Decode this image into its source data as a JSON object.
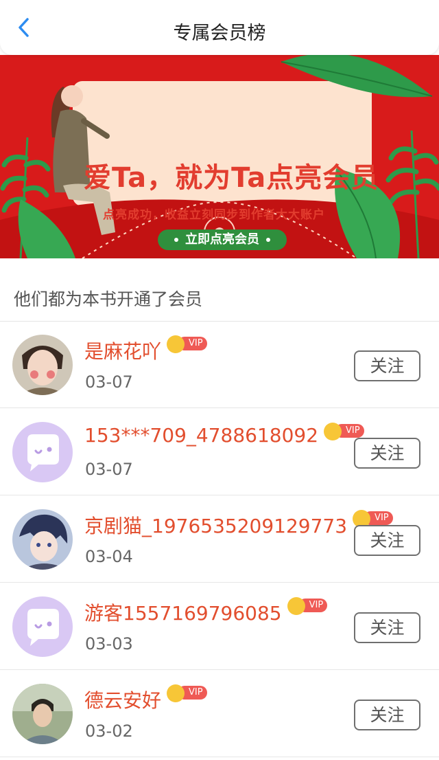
{
  "header": {
    "title": "专属会员榜",
    "back_icon": "chevron-left-icon",
    "back_color": "#2d8cf0"
  },
  "banner": {
    "headline": "爱Ta，就为Ta点亮会员",
    "subtitle": "点亮成功，收益立刻同步到作者大大账户",
    "cta_label": "立即点亮会员",
    "colors": {
      "background": "#d81b1b",
      "card": "#fde3cf",
      "accent": "#e23d2f",
      "cta": "#2f8f3d"
    }
  },
  "section": {
    "title": "他们都为本书开通了会员"
  },
  "vip_badge": {
    "label": "VIP",
    "color": "#ef5a55",
    "crown_color": "#f7c637"
  },
  "members": [
    {
      "name": "是麻花吖",
      "date": "03-07",
      "avatar": "photo-avatar",
      "follow_label": "关注"
    },
    {
      "name": "153***709_4788618092",
      "date": "03-07",
      "avatar": "default-chat-avatar",
      "follow_label": "关注"
    },
    {
      "name": "京剧猫_1976535209129773",
      "date": "03-04",
      "avatar": "anime-avatar",
      "follow_label": "关注"
    },
    {
      "name": "游客1557169796085",
      "date": "03-03",
      "avatar": "default-chat-avatar",
      "follow_label": "关注"
    },
    {
      "name": "德云安好",
      "date": "03-02",
      "avatar": "photo-avatar",
      "follow_label": "关注"
    }
  ]
}
